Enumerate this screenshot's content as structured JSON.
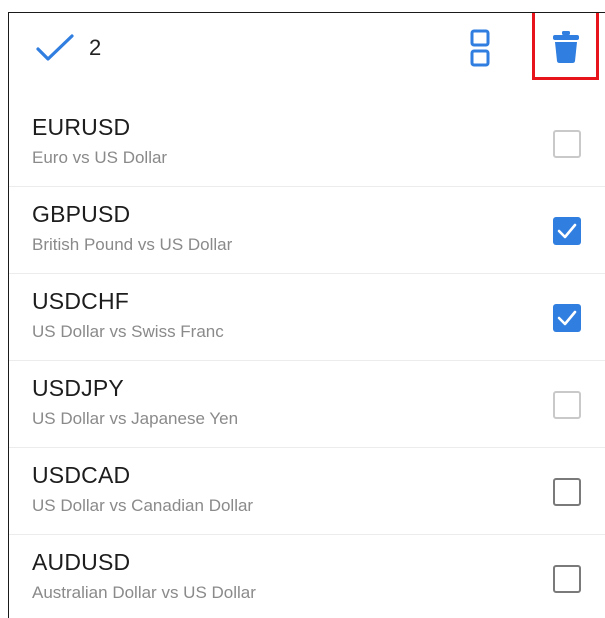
{
  "toolbar": {
    "selected_count": "2",
    "accent_color": "#2f7ee0",
    "highlight_color": "#e8141c",
    "icons": [
      "checkmark-icon",
      "select-all-icon",
      "trash-icon"
    ]
  },
  "symbols": [
    {
      "symbol": "EURUSD",
      "description": "Euro vs US Dollar",
      "checked": false,
      "checkbox_style": "light"
    },
    {
      "symbol": "GBPUSD",
      "description": "British Pound vs US Dollar",
      "checked": true,
      "checkbox_style": "on"
    },
    {
      "symbol": "USDCHF",
      "description": "US Dollar vs Swiss Franc",
      "checked": true,
      "checkbox_style": "on"
    },
    {
      "symbol": "USDJPY",
      "description": "US Dollar vs Japanese Yen",
      "checked": false,
      "checkbox_style": "light"
    },
    {
      "symbol": "USDCAD",
      "description": "US Dollar vs Canadian Dollar",
      "checked": false,
      "checkbox_style": "dark"
    },
    {
      "symbol": "AUDUSD",
      "description": "Australian Dollar vs US Dollar",
      "checked": false,
      "checkbox_style": "dark"
    }
  ]
}
